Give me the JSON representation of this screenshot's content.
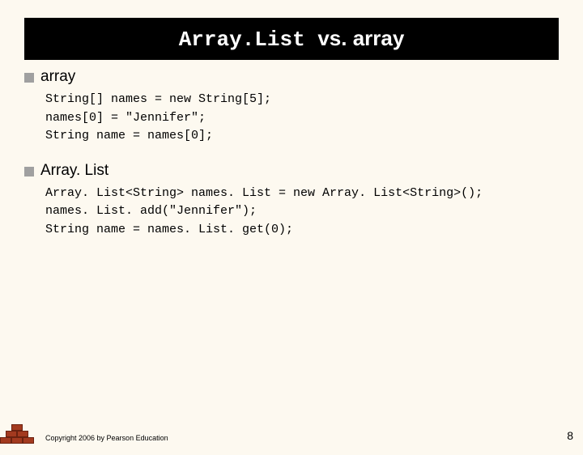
{
  "title": {
    "code_part": "Array.List ",
    "rest_part": "vs. array"
  },
  "sections": [
    {
      "heading": "array",
      "code": [
        "String[] names = new String[5];",
        "names[0] = \"Jennifer\";",
        "String name = names[0];"
      ]
    },
    {
      "heading": "Array. List",
      "code": [
        "Array. List<String> names. List = new Array. List<String>();",
        "names. List. add(\"Jennifer\");",
        "String name = names. List. get(0);"
      ]
    }
  ],
  "footer": {
    "copyright": "Copyright 2006 by Pearson Education",
    "page": "8"
  }
}
